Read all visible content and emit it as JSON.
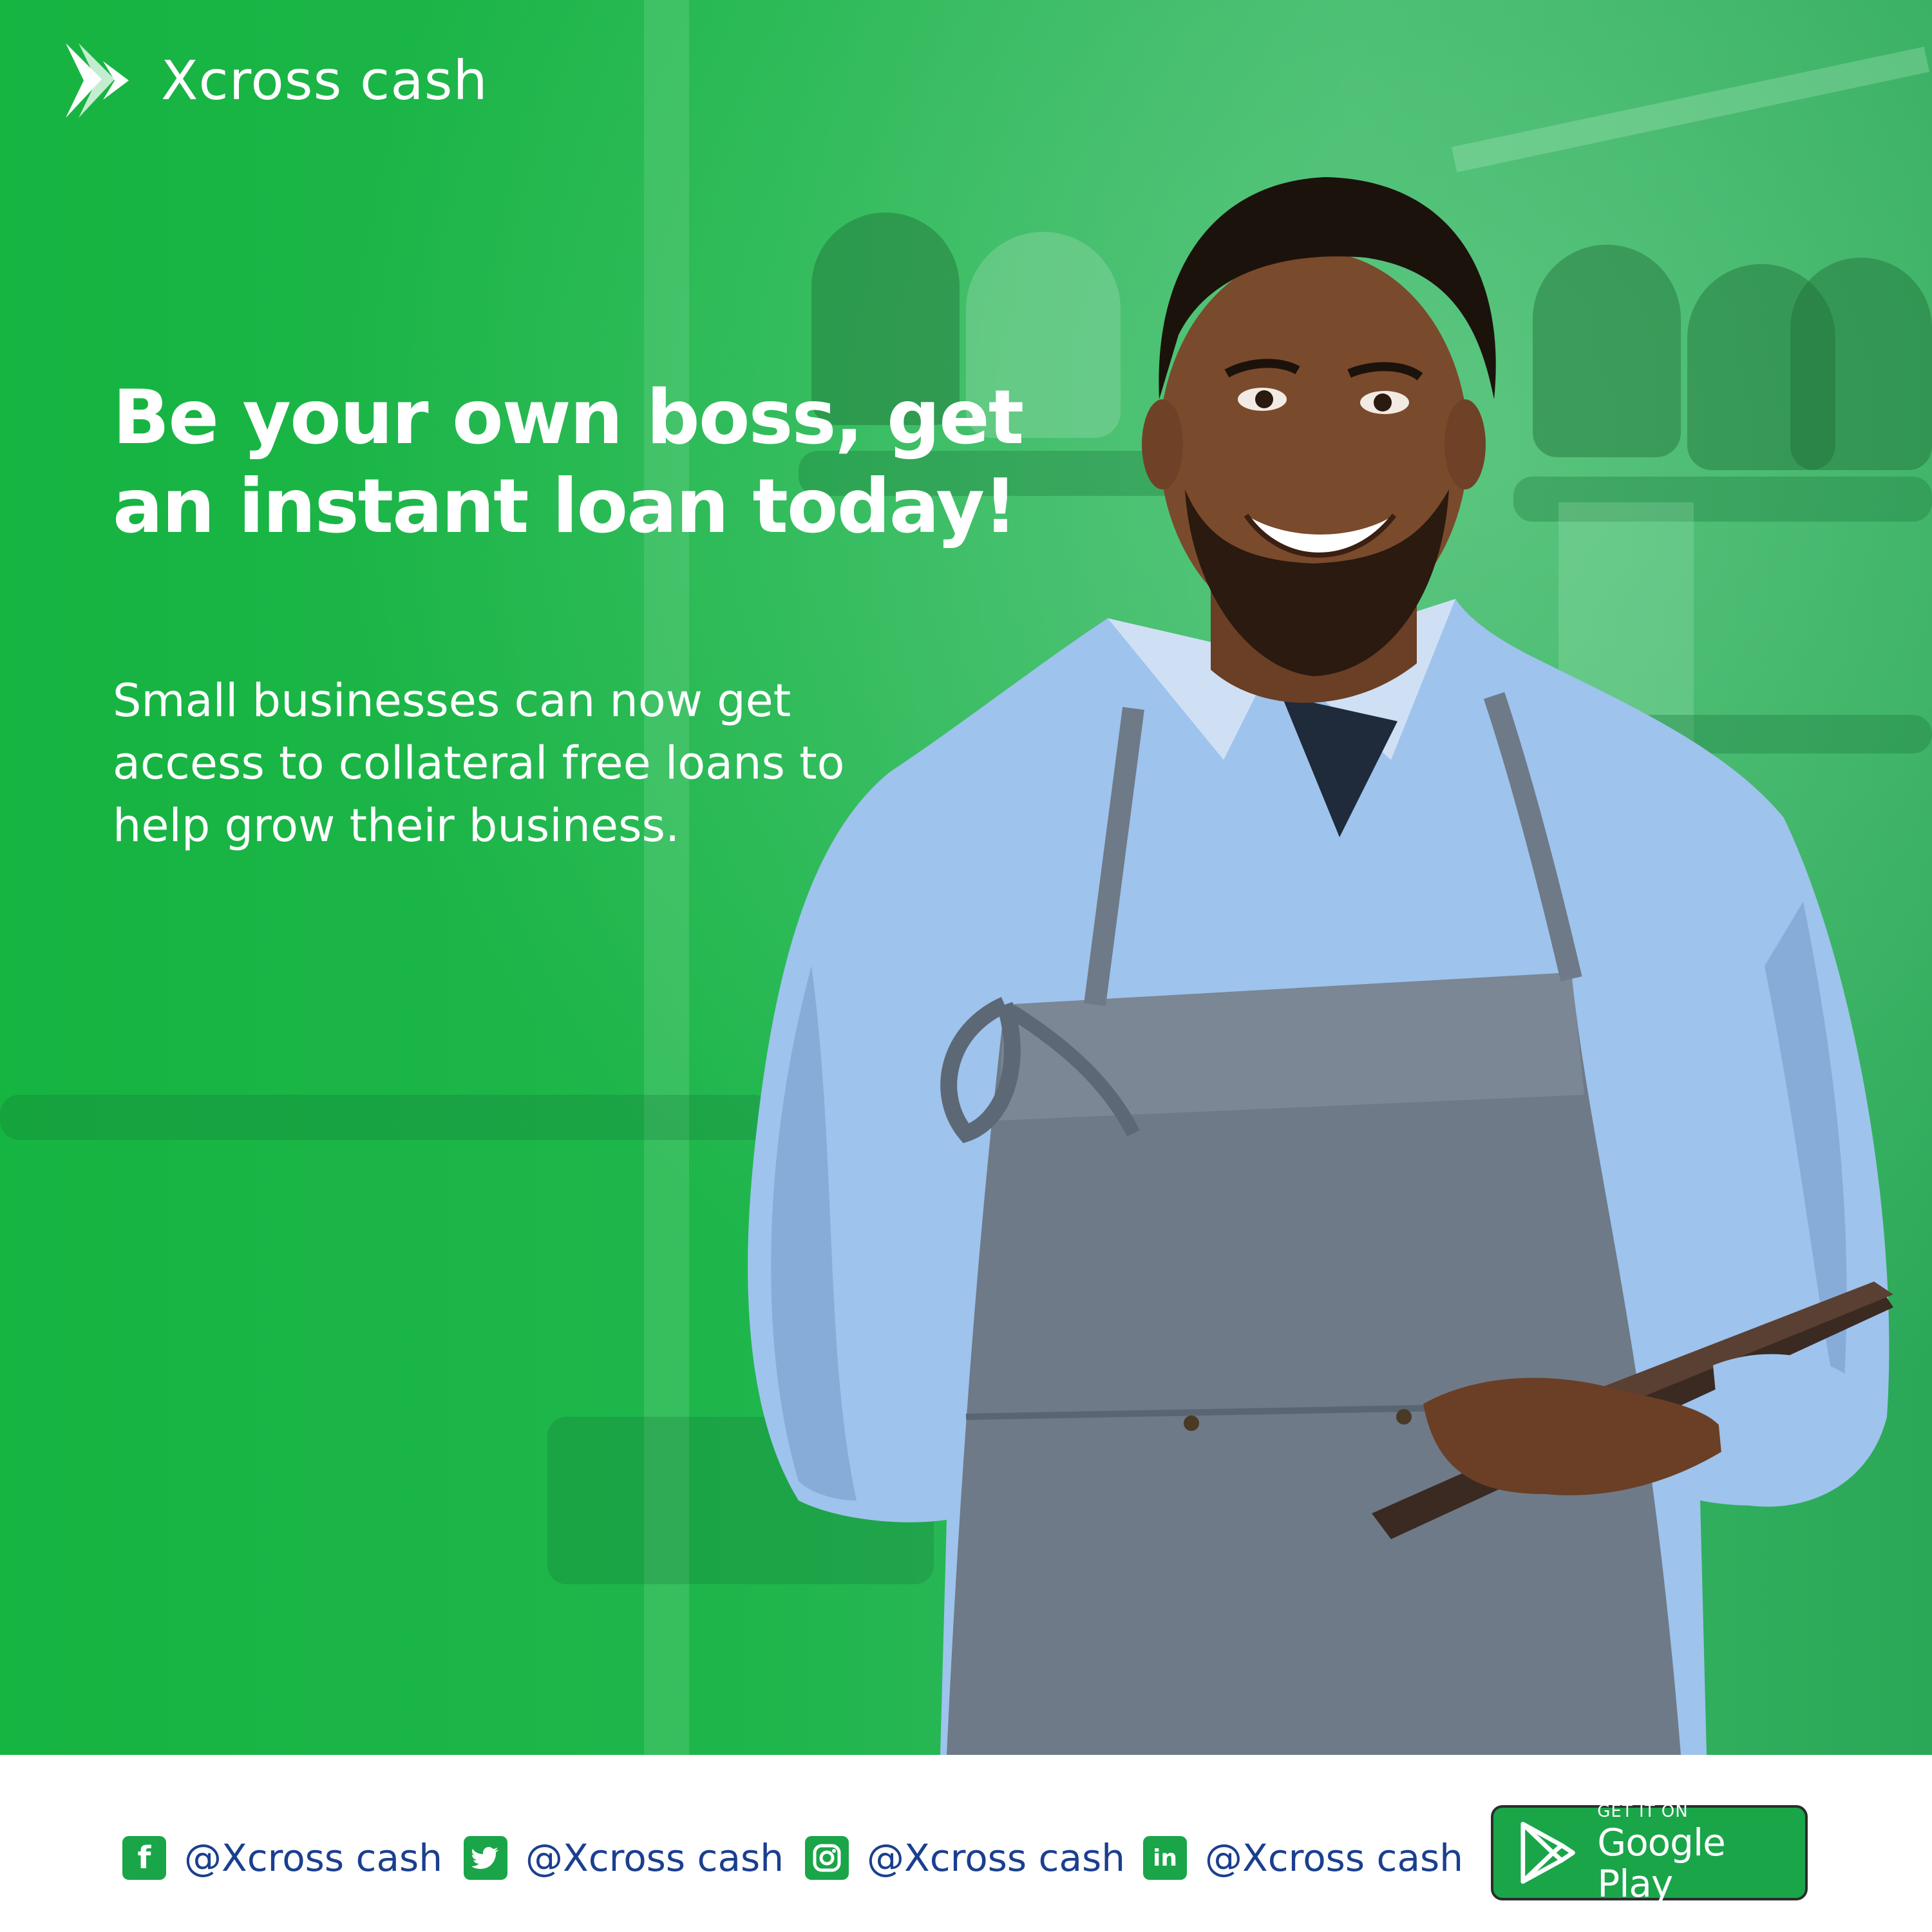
{
  "brand": {
    "name": "Xcross cash",
    "color_primary": "#1aa549",
    "color_link": "#1b3f8f"
  },
  "hero": {
    "headline": "Be your own boss, get an instant loan today!",
    "body": "Small businesses can now get access to collateral free loans to help grow their business."
  },
  "footer": {
    "socials": [
      {
        "icon": "facebook-icon",
        "glyph": "f",
        "handle": "@Xcross cash"
      },
      {
        "icon": "twitter-icon",
        "glyph": "",
        "handle": "@Xcross cash"
      },
      {
        "icon": "instagram-icon",
        "glyph": "",
        "handle": "@Xcross cash"
      },
      {
        "icon": "linkedin-icon",
        "glyph": "in",
        "handle": "@Xcross cash"
      }
    ],
    "store_badge": {
      "small_text": "GET IT ON",
      "big_text": "Google Play"
    }
  }
}
